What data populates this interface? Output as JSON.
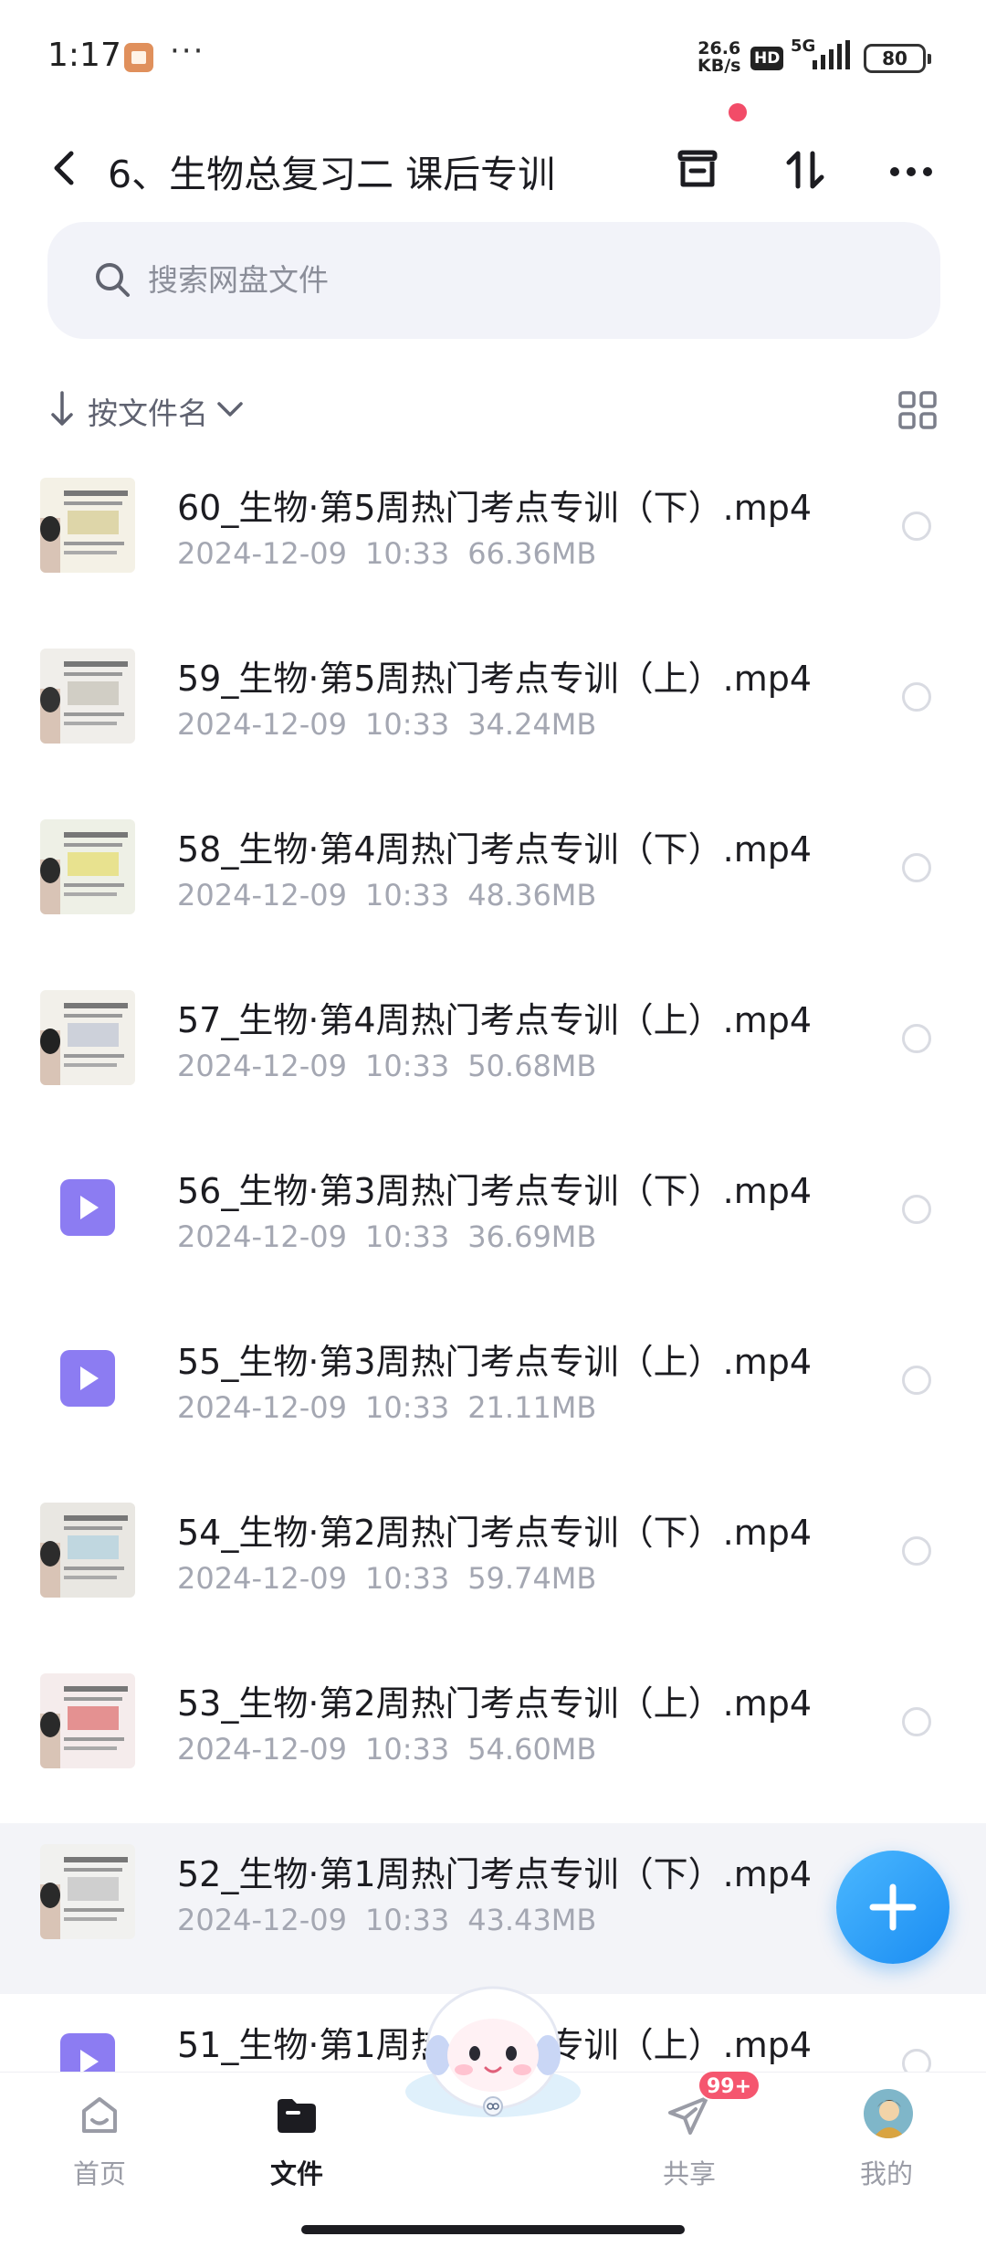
{
  "status_bar": {
    "time": "1:17",
    "dots": "···",
    "net_speed_value": "26.6",
    "net_speed_unit": "KB/s",
    "hd": "HD",
    "network": "5G",
    "battery": "80"
  },
  "header": {
    "title": "6、生物总复习二 课后专训"
  },
  "search": {
    "placeholder": "搜索网盘文件"
  },
  "sort": {
    "label": "按文件名"
  },
  "files": [
    {
      "name": "60_生物·第5周热门考点专训（下）.mp4",
      "date": "2024-12-09",
      "time": "10:33",
      "size": "66.36MB",
      "thumb": "video-frame"
    },
    {
      "name": "59_生物·第5周热门考点专训（上）.mp4",
      "date": "2024-12-09",
      "time": "10:33",
      "size": "34.24MB",
      "thumb": "video-frame"
    },
    {
      "name": "58_生物·第4周热门考点专训（下）.mp4",
      "date": "2024-12-09",
      "time": "10:33",
      "size": "48.36MB",
      "thumb": "video-frame"
    },
    {
      "name": "57_生物·第4周热门考点专训（上）.mp4",
      "date": "2024-12-09",
      "time": "10:33",
      "size": "50.68MB",
      "thumb": "video-frame"
    },
    {
      "name": "56_生物·第3周热门考点专训（下）.mp4",
      "date": "2024-12-09",
      "time": "10:33",
      "size": "36.69MB",
      "thumb": "play-icon"
    },
    {
      "name": "55_生物·第3周热门考点专训（上）.mp4",
      "date": "2024-12-09",
      "time": "10:33",
      "size": "21.11MB",
      "thumb": "play-icon"
    },
    {
      "name": "54_生物·第2周热门考点专训（下）.mp4",
      "date": "2024-12-09",
      "time": "10:33",
      "size": "59.74MB",
      "thumb": "video-frame"
    },
    {
      "name": "53_生物·第2周热门考点专训（上）.mp4",
      "date": "2024-12-09",
      "time": "10:33",
      "size": "54.60MB",
      "thumb": "video-frame"
    },
    {
      "name": "52_生物·第1周热门考点专训（下）.mp4",
      "date": "2024-12-09",
      "time": "10:33",
      "size": "43.43MB",
      "thumb": "video-frame"
    },
    {
      "name": "51_生物·第1周热门考点专训（上）.mp4",
      "date": "",
      "time": "",
      "size": "",
      "thumb": "play-icon"
    }
  ],
  "nav": {
    "home": "首页",
    "files": "文件",
    "share": "共享",
    "share_badge": "99+",
    "mine": "我的"
  },
  "colors": {
    "accent": "#1a8cf2",
    "badge": "#f5566f",
    "play_icon": "#8c7cf2"
  }
}
